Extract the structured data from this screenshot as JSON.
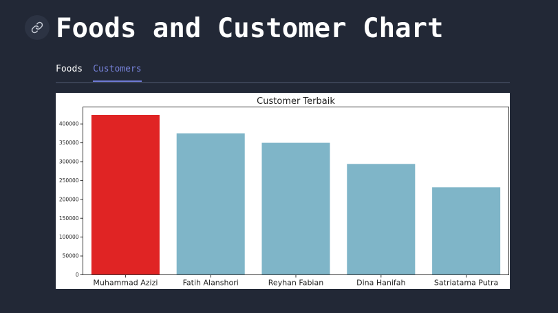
{
  "header": {
    "title": "Foods and Customer Chart",
    "link_icon": "link-icon"
  },
  "tabs": [
    {
      "label": "Foods",
      "active": false
    },
    {
      "label": "Customers",
      "active": true
    }
  ],
  "colors": {
    "background": "#222836",
    "highlight_bar": "#e02424",
    "default_bar": "#7fb5c8",
    "active_tab": "#7681d8"
  },
  "chart_data": {
    "type": "bar",
    "title": "Customer Terbaik",
    "xlabel": "",
    "ylabel": "",
    "categories": [
      "Muhammad Azizi",
      "Fatih Alanshori",
      "Reyhan Fabian",
      "Dina Hanifah",
      "Satriatama Putra"
    ],
    "values": [
      424000,
      375000,
      350000,
      294000,
      232000
    ],
    "highlight_index": 0,
    "ylim": [
      0,
      445000
    ],
    "yticks": [
      0,
      50000,
      100000,
      150000,
      200000,
      250000,
      300000,
      350000,
      400000
    ],
    "grid": false,
    "legend": "none"
  }
}
